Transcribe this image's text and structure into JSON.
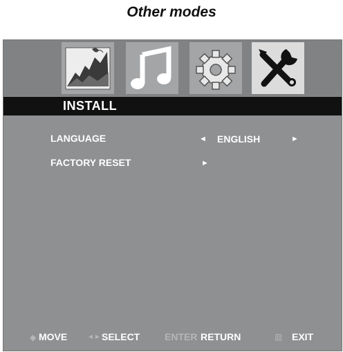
{
  "heading": "Other modes",
  "tabs": [
    {
      "name": "picture-icon"
    },
    {
      "name": "music-icon"
    },
    {
      "name": "settings-gear-icon"
    },
    {
      "name": "install-tools-icon"
    }
  ],
  "menu": {
    "title": "INSTALL",
    "rows": [
      {
        "label": "LANGUAGE",
        "value": "ENGLISH",
        "left_arrow": "◄",
        "right_arrow": "►"
      },
      {
        "label": "FACTORY RESET",
        "right_arrow": "►"
      }
    ]
  },
  "footer": {
    "move_icon": "◆",
    "move": "MOVE",
    "select_icon": "◄►",
    "select": "SELECT",
    "enter": "ENTER",
    "return": "RETURN",
    "exit_icon": "▥",
    "exit": "EXIT"
  },
  "colors": {
    "panel": "#8f9092",
    "header_band": "#808284",
    "title_bar": "#111111",
    "text": "#ffffff"
  }
}
